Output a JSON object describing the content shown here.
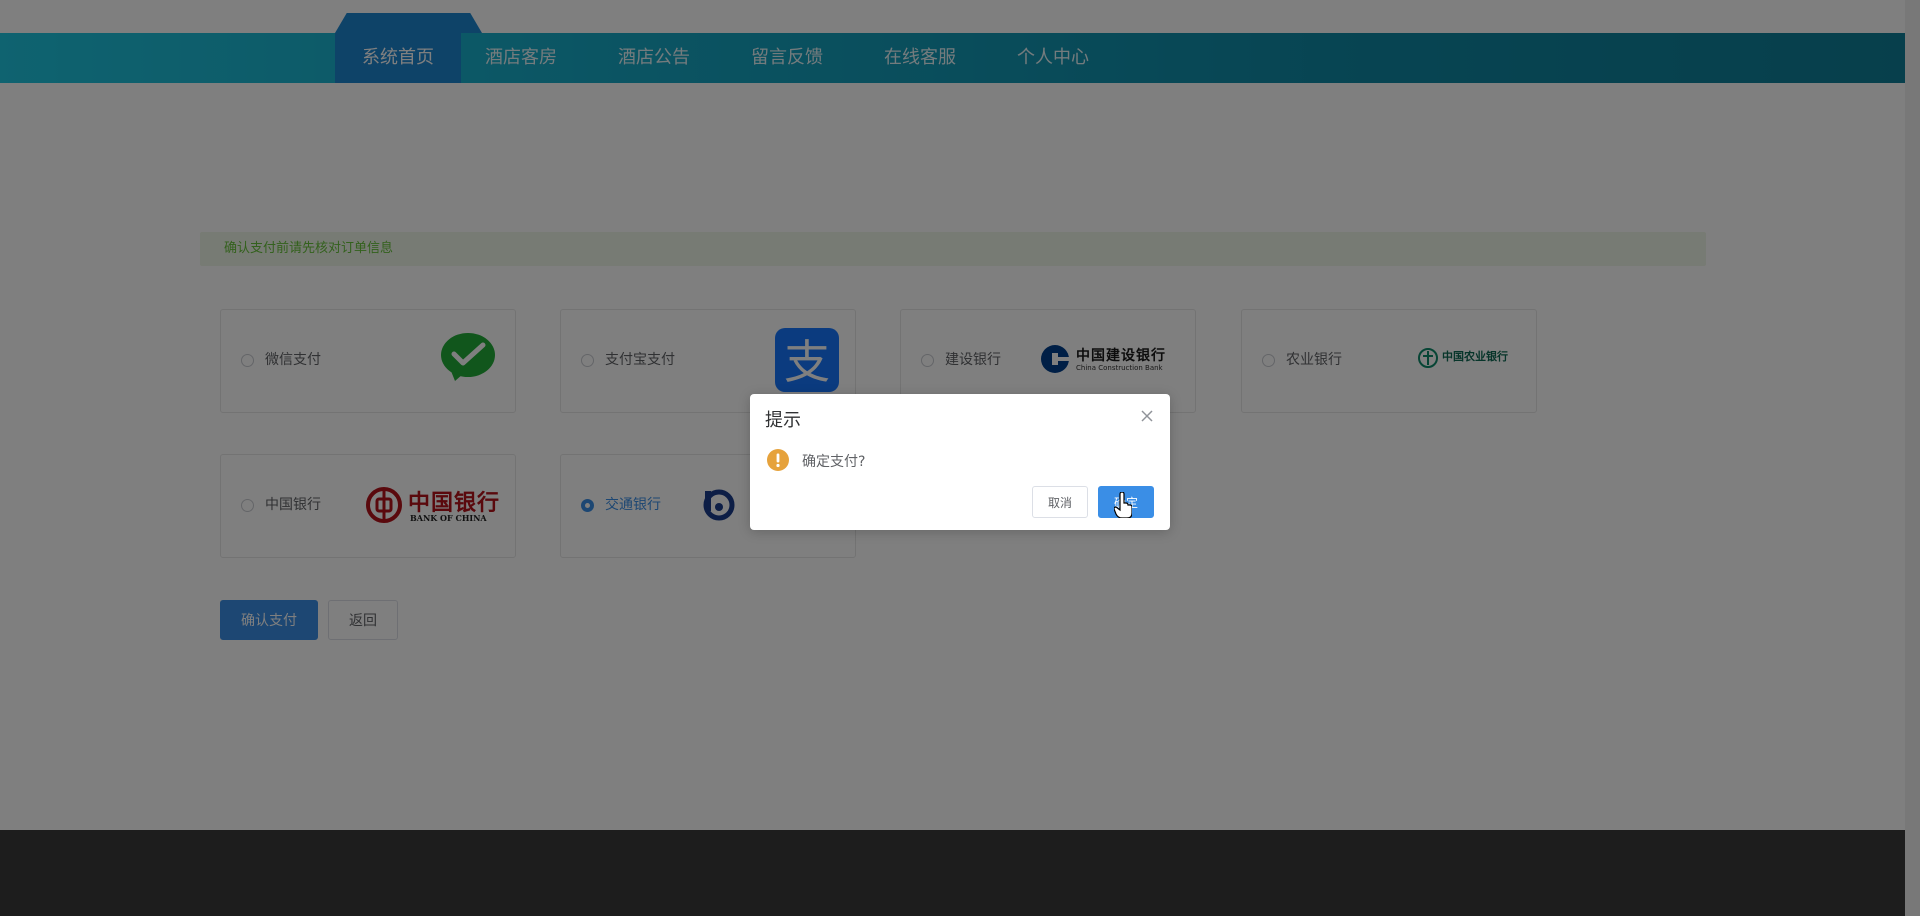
{
  "nav": {
    "items": [
      {
        "label": "系统首页",
        "active": true
      },
      {
        "label": "酒店客房"
      },
      {
        "label": "酒店公告"
      },
      {
        "label": "留言反馈"
      },
      {
        "label": "在线客服"
      },
      {
        "label": "个人中心"
      }
    ]
  },
  "notice": {
    "text": "确认支付前请先核对订单信息"
  },
  "payment": {
    "methods": [
      {
        "label": "微信支付",
        "icon": "wechat-pay-logo",
        "checked": false
      },
      {
        "label": "支付宝支付",
        "icon": "alipay-logo",
        "checked": false
      },
      {
        "label": "建设银行",
        "icon": "ccb-logo",
        "checked": false
      },
      {
        "label": "农业银行",
        "icon": "abc-logo",
        "checked": false
      },
      {
        "label": "中国银行",
        "icon": "boc-logo",
        "checked": false
      },
      {
        "label": "交通银行",
        "icon": "bocom-logo",
        "checked": true
      }
    ],
    "logos": {
      "ccb_cn": "中国建设银行",
      "ccb_en": "China Construction Bank",
      "abc_cn": "中国农业银行",
      "boc_cn": "中国银行",
      "boc_en": "BANK OF CHINA"
    }
  },
  "actions": {
    "confirm_label": "确认支付",
    "back_label": "返回"
  },
  "dialog": {
    "title": "提示",
    "message": "确定支付?",
    "cancel_label": "取消",
    "ok_label": "确定",
    "icon": "warning-icon"
  },
  "colors": {
    "nav_start": "#1ec6e0",
    "nav_end": "#0e7f98",
    "nav_active": "#1d86d0",
    "primary": "#3a8ee6",
    "notice_text": "#67c23a",
    "warning": "#e6a23c",
    "footer": "#3b3b3b"
  }
}
